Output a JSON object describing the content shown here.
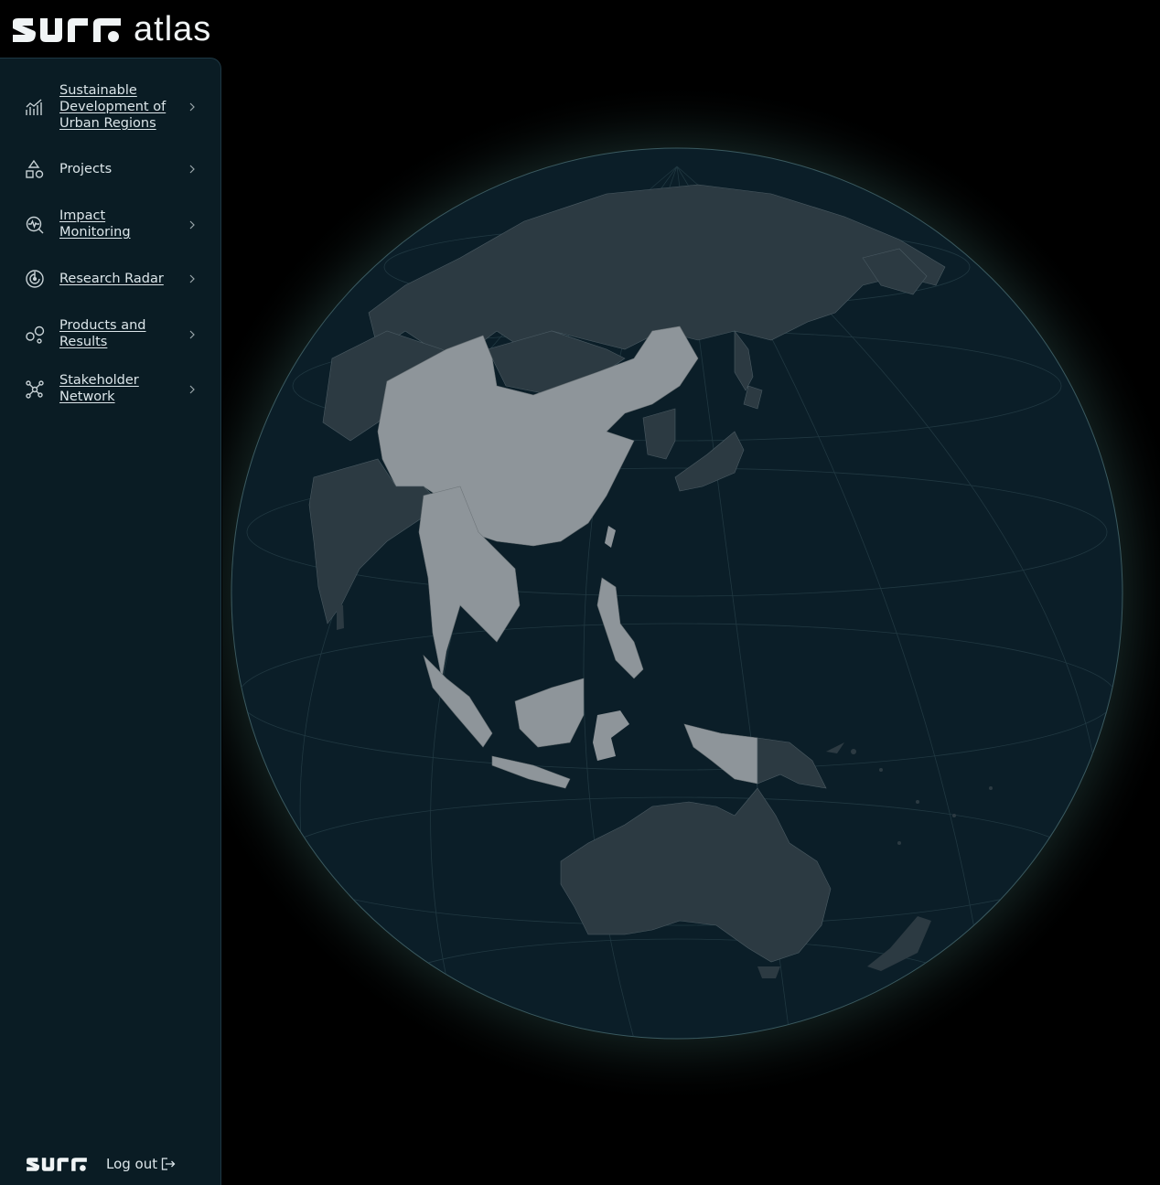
{
  "app": {
    "brand_wordmark": "atlas",
    "brand_logo_text": "surf",
    "footer_logo_text": "surf"
  },
  "sidebar": {
    "items": [
      {
        "label": "Sustainable Development of Urban Regions",
        "icon": "chart-icon"
      },
      {
        "label": "Projects",
        "icon": "shapes-icon"
      },
      {
        "label": "Impact Monitoring",
        "icon": "monitor-search-icon"
      },
      {
        "label": "Research Radar",
        "icon": "radar-icon"
      },
      {
        "label": "Products and Results",
        "icon": "bubbles-icon"
      },
      {
        "label": "Stakeholder Network",
        "icon": "network-icon"
      }
    ],
    "logout_label": "Log out"
  },
  "colors": {
    "background": "#000000",
    "sidebar": "#0a1c24",
    "globe_ocean": "#0b1e28",
    "land": "#2c3a42",
    "land_highlight": "#8e959a",
    "glow": "#2a4a4a"
  }
}
